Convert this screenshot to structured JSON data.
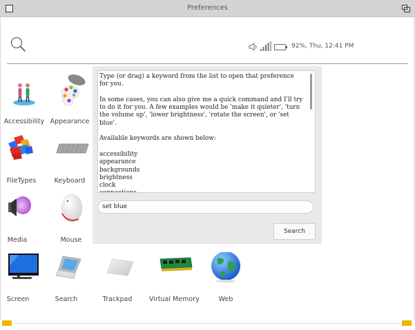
{
  "window": {
    "title": "Preferences"
  },
  "status": {
    "battery_text": "92%, Thu, 12:41 PM"
  },
  "prefs": [
    {
      "label": "Accessibility"
    },
    {
      "label": "Appearance"
    },
    {
      "label": "FileTypes"
    },
    {
      "label": "Keyboard"
    },
    {
      "label": "Media"
    },
    {
      "label": "Mouse"
    },
    {
      "label": "Screen"
    },
    {
      "label": "Search"
    },
    {
      "label": "Trackpad"
    },
    {
      "label": "Virtual Memory"
    },
    {
      "label": "Web"
    }
  ],
  "panel": {
    "help_text": "Type (or drag) a keyword from the list to open that preference for you.\n\nIn some cases, you can also give me a quick command and I'll try to do it for you. A few examples would be 'make it quieter', 'turn the volume up', 'lower brightness', 'rotate the screen', or 'set blue'.\n\nAvailable keywords are shown below:\n\naccessibility\nappearance\nbackgrounds\nbrightness\nclock\nconnections",
    "command_value": "set blue",
    "search_label": "Search"
  },
  "colors": {
    "scroll_accent": "#f0b400"
  }
}
